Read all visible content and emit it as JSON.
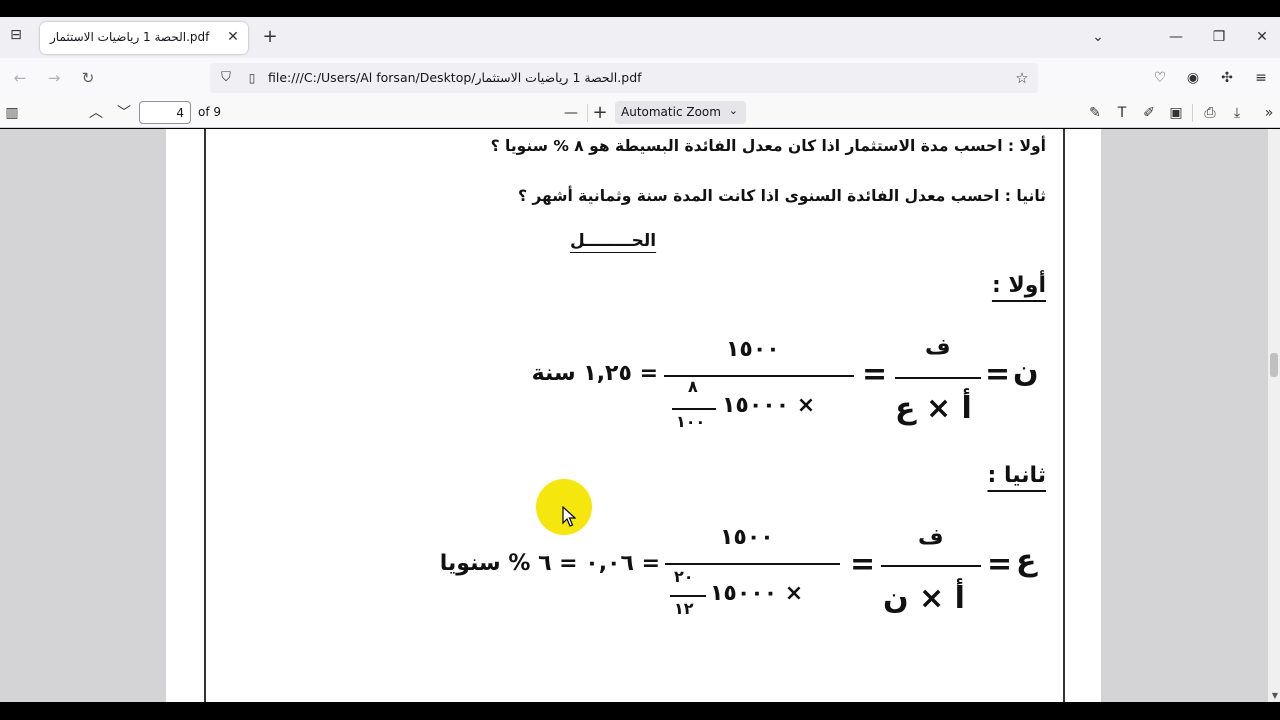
{
  "browser": {
    "tab_title": "الحصة 1 رياضيات الاستثمار.pdf",
    "url": "file:///C:/Users/Al forsan/Desktop/الحصة 1 رياضيات الاستثمار.pdf",
    "icons": [
      "tab-list-icon",
      "close-icon",
      "plus-icon",
      "chevron-down-icon",
      "minimize-icon",
      "restore-icon",
      "back-icon",
      "forward-icon",
      "reload-icon",
      "shield-icon",
      "page-icon",
      "star-icon",
      "pocket-icon",
      "account-icon",
      "extensions-icon",
      "menu-icon"
    ]
  },
  "pdf_toolbar": {
    "page_number": "4",
    "page_count": "of 9",
    "zoom_minus": "—",
    "zoom_plus": "+",
    "zoom": "Automatic Zoom"
  },
  "document": {
    "question1": "أولا : احسب مدة الاستثمار اذا كان معدل الفائدة البسيطة هو ٨ % سنويا ؟",
    "question2": "ثانيا : احسب معدل الفائدة السنوى اذا كانت المدة سنة وثمانية أشهر ؟",
    "solution_title": "الحــــــــل",
    "part1_title": "أولا :",
    "part2_title": "ثانيا :",
    "eq1": {
      "lhs": "ن",
      "eq": "=",
      "sym_num": "ف",
      "sym_den": "أ × ع",
      "num": "١٥٠٠",
      "den_main": "١٥٠٠٠ ×",
      "den_frac_num": "٨",
      "den_frac_den": "١٠٠",
      "result": "= ١,٢٥ سنة"
    },
    "eq2": {
      "lhs": "ع",
      "eq": "=",
      "sym_num": "ف",
      "sym_den": "أ × ن",
      "num": "١٥٠٠",
      "den_main": "١٥٠٠٠ ×",
      "den_frac_num": "٢٠",
      "den_frac_den": "١٢",
      "result": "= ٠,٠٦ = ٦ % سنويا"
    }
  }
}
